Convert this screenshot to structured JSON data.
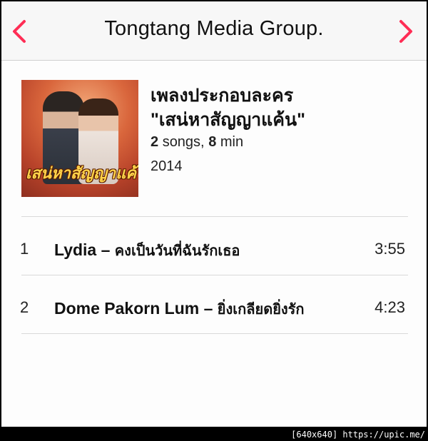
{
  "navbar": {
    "title": "Tongtang Media Group.",
    "back_icon": "chevron-left-icon",
    "forward_icon": "chevron-right-icon",
    "accent_color": "#ff2d55"
  },
  "album": {
    "cover_text": "เสน่หาสัญญาแค้น",
    "title_line1": "เพลงประกอบละคร",
    "title_line2": "\"เสน่หาสัญญาแค้น\"",
    "song_count": "2",
    "songs_label": "songs,",
    "duration": "8",
    "duration_unit": "min",
    "year": "2014"
  },
  "tracks": [
    {
      "number": "1",
      "artist": "Lydia",
      "separator": "–",
      "song": "คงเป็นวันที่ฉันรักเธอ",
      "duration": "3:55"
    },
    {
      "number": "2",
      "artist": "Dome Pakorn Lum",
      "separator": "–",
      "song": "ยิ่งเกลียดยิ่งรัก",
      "duration": "4:23"
    }
  ],
  "footer": {
    "text": "[640x640] https://upic.me/"
  }
}
